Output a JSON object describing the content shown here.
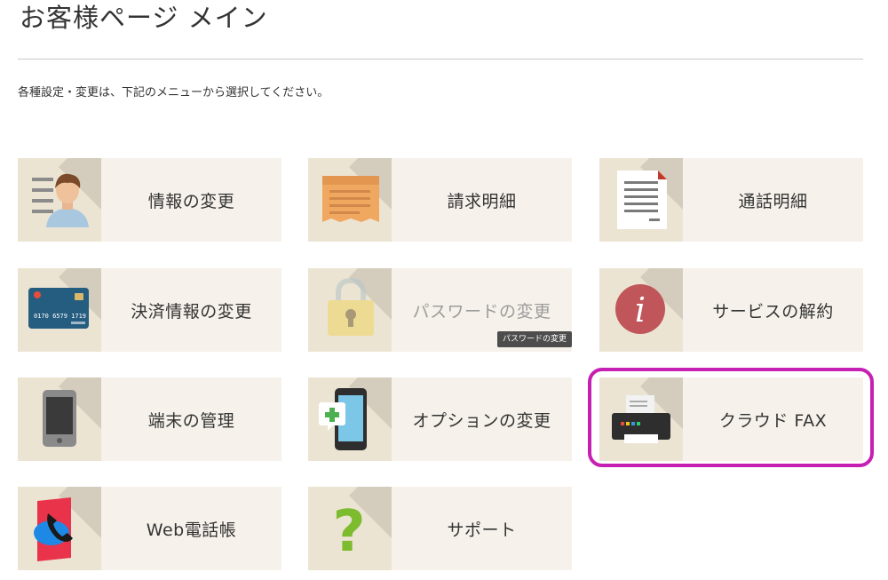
{
  "page": {
    "title": "お客様ページ メイン",
    "intro": "各種設定・変更は、下記のメニューから選択してください。"
  },
  "menu": [
    {
      "id": "info",
      "label": "情報の変更",
      "icon": "person-with-list-icon"
    },
    {
      "id": "billing",
      "label": "請求明細",
      "icon": "receipt-icon"
    },
    {
      "id": "call-detail",
      "label": "通話明細",
      "icon": "document-icon"
    },
    {
      "id": "payment",
      "label": "決済情報の変更",
      "icon": "credit-card-icon",
      "card_number": "0170 6579 1719"
    },
    {
      "id": "password",
      "label": "パスワードの変更",
      "icon": "padlock-icon",
      "disabled": true,
      "tooltip": "パスワードの変更"
    },
    {
      "id": "cancel",
      "label": "サービスの解約",
      "icon": "info-icon"
    },
    {
      "id": "device",
      "label": "端末の管理",
      "icon": "mobile-phone-icon"
    },
    {
      "id": "options",
      "label": "オプションの変更",
      "icon": "smartphone-plus-icon"
    },
    {
      "id": "cloud-fax",
      "label": "クラウド FAX",
      "icon": "fax-printer-icon",
      "highlighted": true
    },
    {
      "id": "web-phonebook",
      "label": "Web電話帳",
      "icon": "phonebook-icon"
    },
    {
      "id": "support",
      "label": "サポート",
      "icon": "question-mark-icon"
    }
  ],
  "colors": {
    "tile_bg": "#f6f2eb",
    "icon_bg": "#ece4d3",
    "highlight": "#c620b3",
    "tooltip_bg": "#4d4d4d"
  }
}
